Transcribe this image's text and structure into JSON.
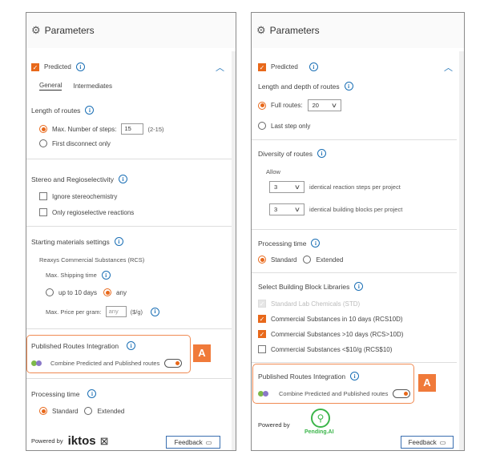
{
  "left": {
    "header_title": "Parameters",
    "predicted_label": "Predicted",
    "tabs": [
      "General",
      "Intermediates"
    ],
    "length_title": "Length of routes",
    "max_steps_label": "Max. Number of steps:",
    "max_steps_value": "15",
    "max_steps_range": "(2-15)",
    "first_disconnect_label": "First disconnect only",
    "stereo_title": "Stereo and Regioselectivity",
    "ignore_stereo_label": "Ignore stereochemistry",
    "only_regio_label": "Only regioselective reactions",
    "starting_title": "Starting materials settings",
    "reaxys_label": "Reaxys Commercial Substances (RCS)",
    "shipping_label": "Max. Shipping time",
    "upto10_label": "up to 10 days",
    "any_label": "any",
    "max_price_label": "Max. Price per gram:",
    "max_price_placeholder": "any",
    "max_price_unit": "($/g)",
    "published_title": "Published Routes Integration",
    "combine_label": "Combine Predicted and Published routes",
    "processing_title": "Processing time",
    "standard_label": "Standard",
    "extended_label": "Extended",
    "powered_by": "Powered by",
    "brand": "iktos",
    "feedback_label": "Feedback",
    "callout_letter": "A"
  },
  "right": {
    "header_title": "Parameters",
    "predicted_label": "Predicted",
    "length_depth_title": "Length and depth of routes",
    "full_routes_label": "Full routes:",
    "full_routes_value": "20",
    "last_step_label": "Last step only",
    "diversity_title": "Diversity of routes",
    "allow_label": "Allow",
    "reaction_steps_value": "3",
    "reaction_steps_label": "identical reaction steps per project",
    "building_blocks_value": "3",
    "building_blocks_label": "identical building blocks per project",
    "processing_title": "Processing time",
    "standard_label": "Standard",
    "extended_label": "Extended",
    "libraries_title": "Select Building Block Libraries",
    "libraries": [
      {
        "label": "Standard Lab Chemicals (STD)",
        "state": "disabled"
      },
      {
        "label": "Commercial Substances in 10 days (RCS10D)",
        "state": "checked"
      },
      {
        "label": "Commercial Substances >10 days (RCS>10D)",
        "state": "checked"
      },
      {
        "label": "Commercial Substances <$10/g (RCS$10)",
        "state": "unchecked"
      }
    ],
    "published_title": "Published Routes Integration",
    "combine_label": "Combine Predicted and Published routes",
    "powered_by": "Powered by",
    "brand": "Pending.AI",
    "feedback_label": "Feedback",
    "callout_letter": "A"
  },
  "colors": {
    "accent": "#e8681a",
    "info": "#1a6fb5",
    "callout": "#f07a3a",
    "brand_green": "#3bb54a"
  }
}
